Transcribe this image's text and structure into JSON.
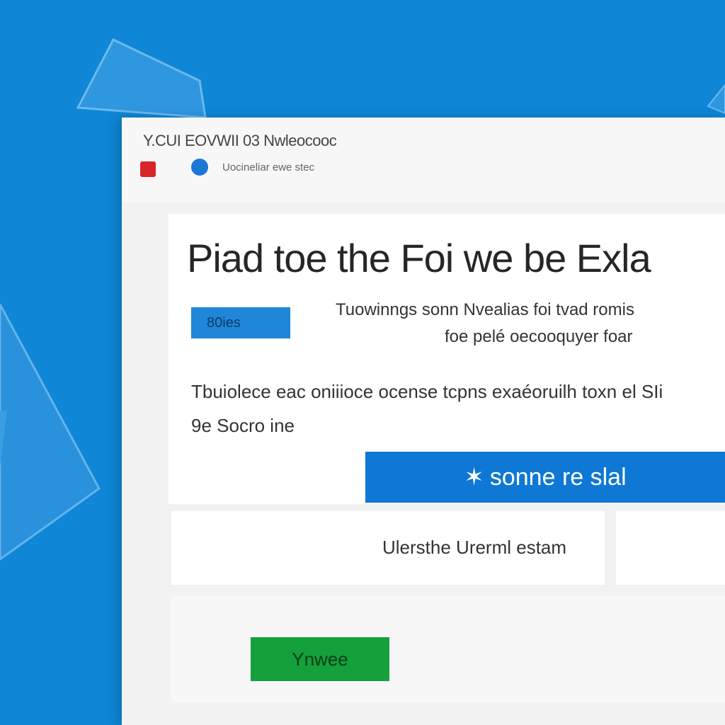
{
  "colors": {
    "desktop_background": "#0f86d6",
    "accent_blue": "#0f78d4",
    "red": "#d9252a",
    "green": "#14a03a"
  },
  "window": {
    "title": "Y.CUI EOVWII 03 Nwleocooc",
    "address": "Uocineliar ewe stec"
  },
  "card": {
    "headline": "Piad toe the Foi we be Exla",
    "badge": "80ies",
    "sub_line_1": "Tuowinngs sonn Nvealias foi tvad romis",
    "sub_line_2": "foe pelé oecooquyer foar",
    "body_line_1": "Tbuiolece eac oniiioce ocense tcpns exaéoruilh toxn el SIi",
    "body_line_2": "9e Socro ine",
    "primary_button": "sonne re slal",
    "primary_button_icon": "star-icon"
  },
  "options": {
    "left_label": "Ulersthe Urerml estam"
  },
  "footer": {
    "ok_button": "Ynwee"
  }
}
